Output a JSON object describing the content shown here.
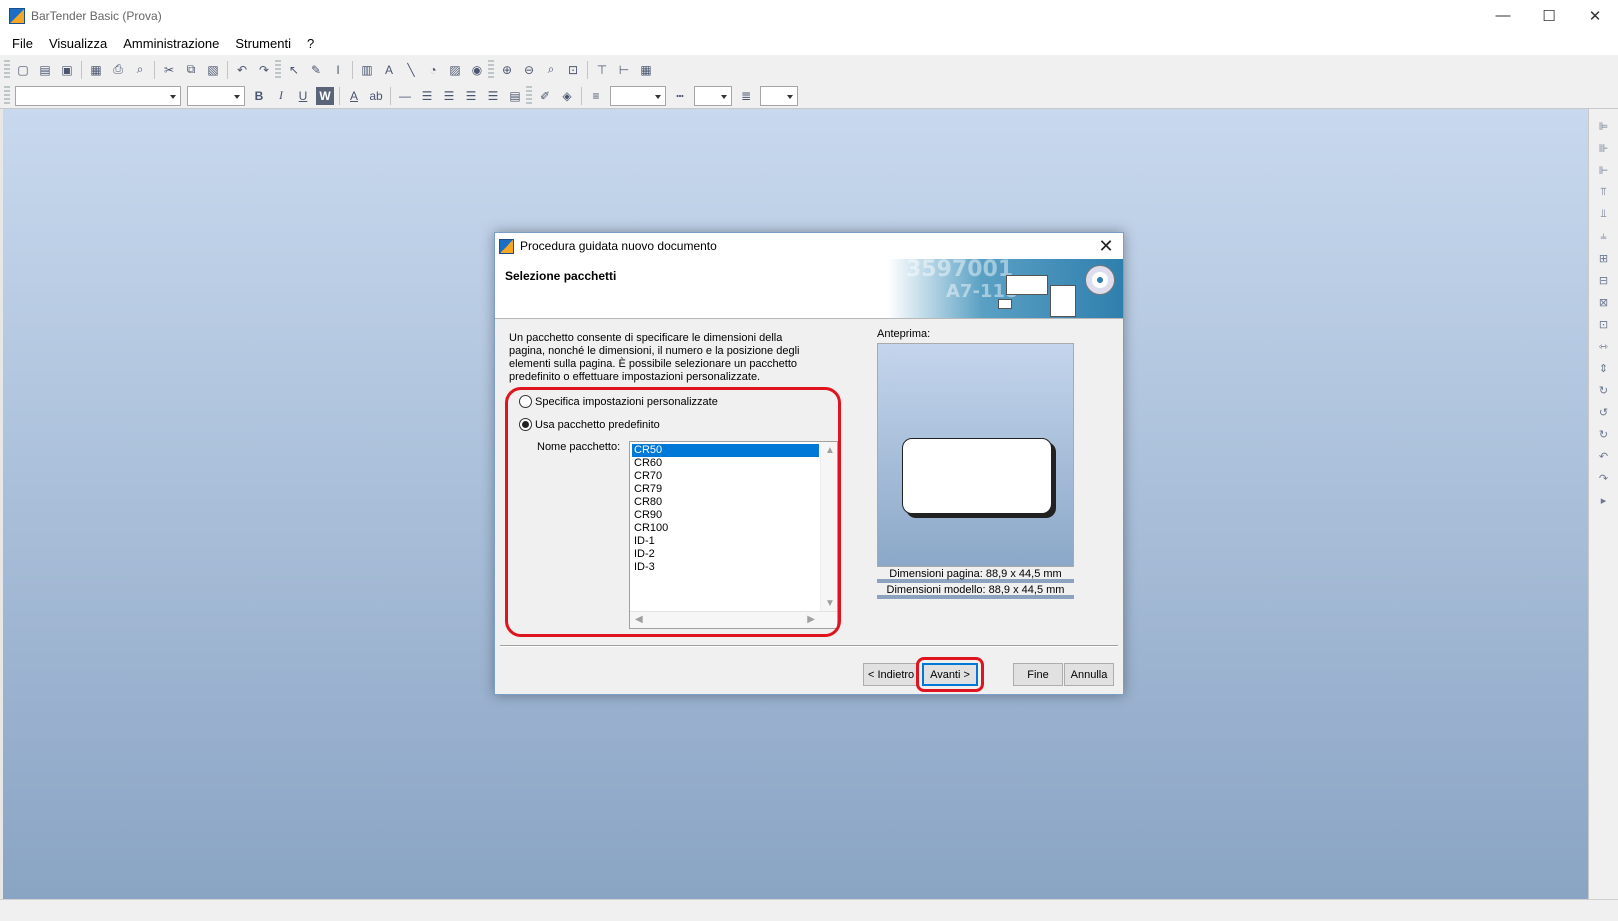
{
  "window": {
    "title": "BarTender Basic (Prova)",
    "minimize_glyph": "—",
    "maximize_glyph": "☐",
    "close_glyph": "✕"
  },
  "menu": {
    "items": [
      "File",
      "Visualizza",
      "Amministrazione",
      "Strumenti",
      "?"
    ]
  },
  "toolbar": {
    "row1_icons": [
      "new-icon",
      "open-icon",
      "save-icon",
      "sep",
      "page-setup-icon",
      "print-icon",
      "print-preview-icon",
      "sep",
      "cut-icon",
      "copy-icon",
      "paste-icon",
      "sep",
      "undo-icon",
      "redo-icon",
      "grip",
      "select-icon",
      "paintbrush-icon",
      "text-cursor-icon",
      "sep",
      "barcode-icon",
      "text-icon",
      "line-icon",
      "shape-icon",
      "picture-icon",
      "rfid-icon",
      "grip",
      "zoom-in-icon",
      "zoom-out-icon",
      "zoom-icon",
      "fit-icon",
      "sep",
      "ruler-h-icon",
      "ruler-v-icon",
      "grid-icon"
    ],
    "bold": "B",
    "italic": "I",
    "underline": "U",
    "word": "W",
    "font_color": "A"
  },
  "dialog": {
    "title": "Procedura guidata nuovo documento",
    "heading": "Selezione pacchetti",
    "description": "Un pacchetto consente di specificare le dimensioni della pagina, nonché le dimensioni, il numero e la posizione degli elementi sulla pagina. È possibile selezionare un pacchetto predefinito o effettuare impostazioni personalizzate.",
    "art_text_1": "3597001",
    "art_text_2": "A7-118",
    "option_custom": "Specifica impostazioni personalizzate",
    "option_predefined": "Usa pacchetto predefinito",
    "selected_option": "predefined",
    "package_label": "Nome pacchetto:",
    "packages": [
      "CR50",
      "CR60",
      "CR70",
      "CR79",
      "CR80",
      "CR90",
      "CR100",
      "ID-1",
      "ID-2",
      "ID-3"
    ],
    "selected_package": "CR50",
    "preview_label": "Anteprima:",
    "page_dimensions": "Dimensioni pagina:  88,9 x 44,5 mm",
    "template_dimensions": "Dimensioni modello:  88,9 x 44,5 mm",
    "buttons": {
      "back": "< Indietro",
      "next": "Avanti  >",
      "finish": "Fine",
      "cancel": "Annulla"
    },
    "close_glyph": "✕"
  },
  "colors": {
    "highlight": "#e0141e",
    "selection": "#0078d7",
    "workspace_top": "#c8d9ee",
    "workspace_bottom": "#8aa4c4"
  }
}
